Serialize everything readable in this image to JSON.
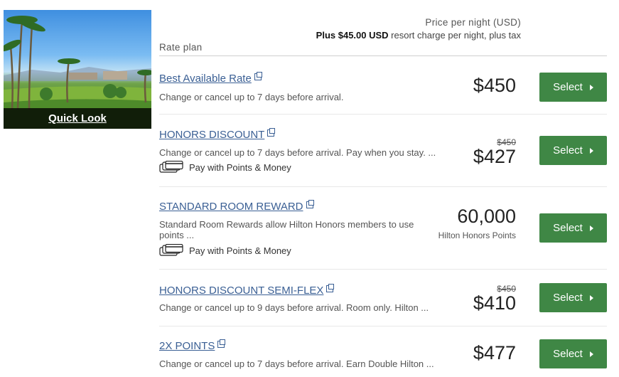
{
  "image": {
    "quick_look_label": "Quick Look"
  },
  "header": {
    "rate_plan_label": "Rate plan",
    "price_label": "Price per night (USD)",
    "resort_bold": "Plus $45.00 USD",
    "resort_rest": " resort charge per night, plus tax"
  },
  "rates": [
    {
      "name": "Best Available Rate",
      "description": "Change or cancel up to 7 days before arrival.",
      "points_money": "",
      "original_price": "",
      "price": "$450",
      "price_unit": "",
      "button": "Select"
    },
    {
      "name": "HONORS DISCOUNT",
      "description": "Change or cancel up to 7 days before arrival. Pay when you stay. ...",
      "points_money": "Pay with Points & Money",
      "original_price": "$450",
      "price": "$427",
      "price_unit": "",
      "button": "Select"
    },
    {
      "name": "STANDARD ROOM REWARD",
      "description": "Standard Room Rewards allow Hilton Honors members to use points ...",
      "points_money": "Pay with Points & Money",
      "original_price": "",
      "price": "60,000",
      "price_unit": "Hilton Honors Points",
      "button": "Select"
    },
    {
      "name": "HONORS DISCOUNT SEMI-FLEX",
      "description": "Change or cancel up to 9 days before arrival. Room only. Hilton ...",
      "points_money": "",
      "original_price": "$450",
      "price": "$410",
      "price_unit": "",
      "button": "Select"
    },
    {
      "name": "2X POINTS",
      "description": "Change or cancel up to 7 days before arrival. Earn Double Hilton ...",
      "points_money": "",
      "original_price": "",
      "price": "$477",
      "price_unit": "",
      "button": "Select"
    }
  ],
  "colors": {
    "link": "#3a5f94",
    "button": "#3f8745"
  },
  "icons": {
    "external": "external-link-icon",
    "points_money": "cards-icon",
    "button": "chevron-right-icon"
  }
}
